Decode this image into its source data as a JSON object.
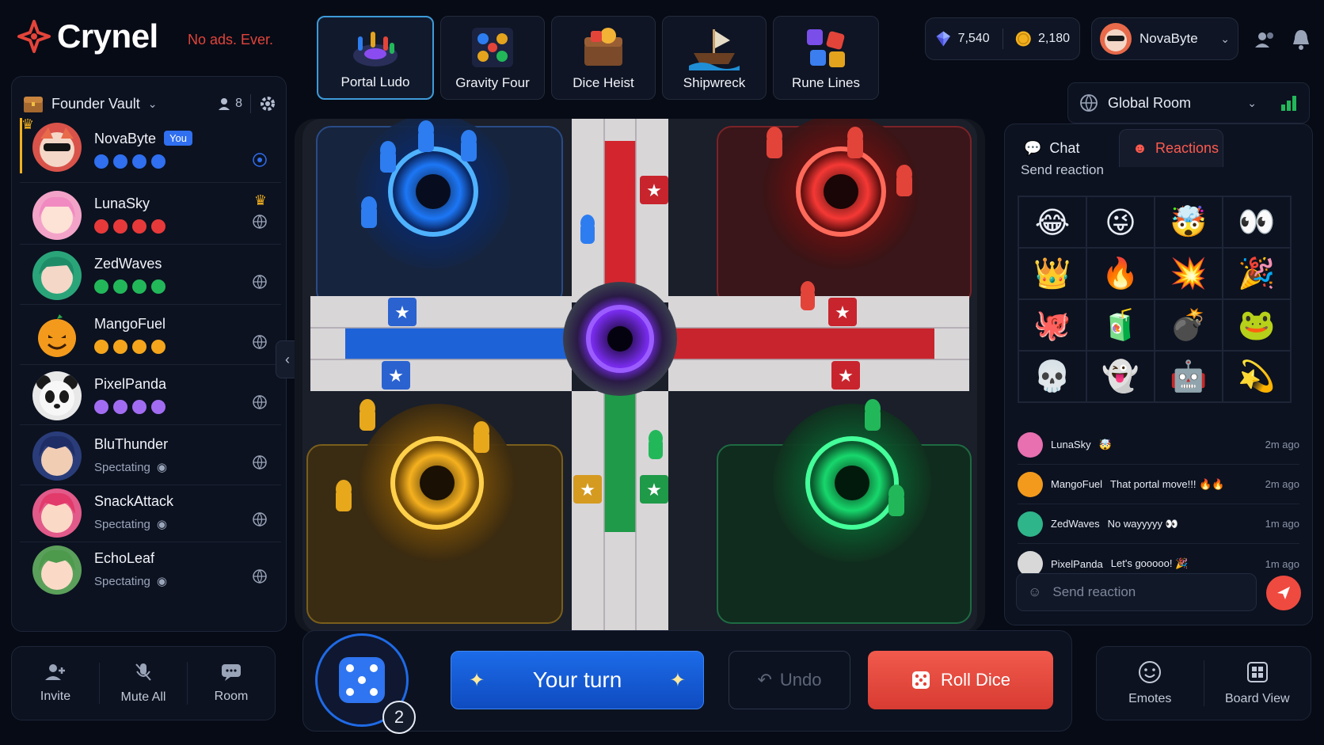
{
  "brand": {
    "name": "Crynel",
    "tagline": "No ads. Ever."
  },
  "game_tabs": [
    {
      "label": "Portal Ludo",
      "active": true
    },
    {
      "label": "Gravity Four",
      "active": false
    },
    {
      "label": "Dice Heist",
      "active": false
    },
    {
      "label": "Shipwreck",
      "active": false
    },
    {
      "label": "Rune Lines",
      "active": false
    }
  ],
  "currency": {
    "gems": "7,540",
    "coins": "2,180"
  },
  "user": {
    "name": "NovaByte"
  },
  "vault": {
    "title": "Founder Vault",
    "member_count": "8"
  },
  "players": [
    {
      "name": "NovaByte",
      "badge": "You",
      "status": "dots",
      "color": "#2f6ff0",
      "host": true
    },
    {
      "name": "LunaSky",
      "status": "dots",
      "color": "#e8393a",
      "crown": true
    },
    {
      "name": "ZedWaves",
      "status": "dots",
      "color": "#22b85a"
    },
    {
      "name": "MangoFuel",
      "status": "dots",
      "color": "#f4a51c"
    },
    {
      "name": "PixelPanda",
      "status": "dots",
      "color": "#a26cf2"
    },
    {
      "name": "BluThunder",
      "status": "spectating",
      "status_label": "Spectating"
    },
    {
      "name": "SnackAttack",
      "status": "spectating",
      "status_label": "Spectating"
    },
    {
      "name": "EchoLeaf",
      "status": "spectating",
      "status_label": "Spectating"
    }
  ],
  "left_actions": {
    "invite": "Invite",
    "mute_all": "Mute All",
    "room": "Room"
  },
  "controls": {
    "dice_value": "2",
    "your_turn": "Your turn",
    "undo": "Undo",
    "roll": "Roll Dice"
  },
  "right_actions": {
    "emotes": "Emotes",
    "board_view": "Board View"
  },
  "room": {
    "selected": "Global Room"
  },
  "chat": {
    "tab_chat": "Chat",
    "tab_reactions": "Reactions",
    "section_title": "Send reaction",
    "emojis": [
      "😂",
      "😜",
      "🤯",
      "👀",
      "👑",
      "🔥",
      "💥",
      "🎉",
      "🐙",
      "🧃",
      "💣",
      "🐸",
      "💀",
      "👻",
      "🤖",
      "💫"
    ],
    "messages": [
      {
        "user": "LunaSky",
        "text": "🤯",
        "time": "2m ago",
        "color": "#e86fb0"
      },
      {
        "user": "MangoFuel",
        "text": "That portal move!!! 🔥🔥",
        "time": "2m ago",
        "color": "#f39a1c"
      },
      {
        "user": "ZedWaves",
        "text": "No wayyyyy 👀",
        "time": "1m ago",
        "color": "#2fb58a"
      },
      {
        "user": "PixelPanda",
        "text": "Let's gooooo! 🎉",
        "time": "1m ago",
        "color": "#d8d8d8"
      }
    ],
    "input_placeholder": "Send reaction"
  }
}
